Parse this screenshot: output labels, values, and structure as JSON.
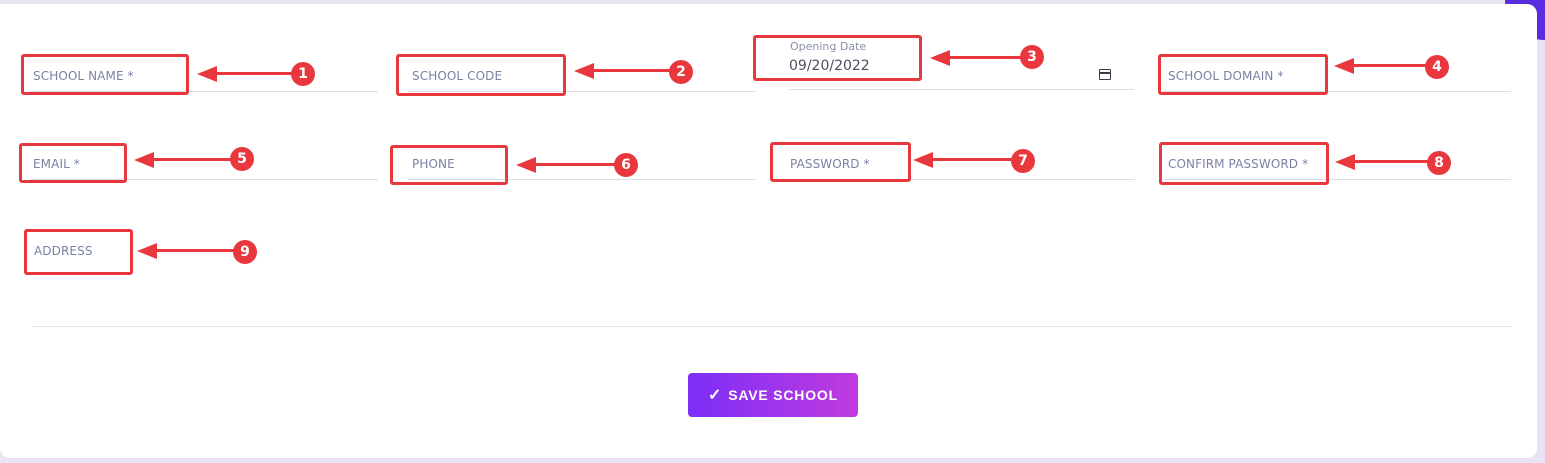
{
  "form": {
    "school_name_label": "SCHOOL NAME *",
    "school_code_label": "SCHOOL CODE",
    "opening_date_label": "Opening Date",
    "opening_date_value": "09/20/2022",
    "school_domain_label": "SCHOOL DOMAIN *",
    "email_label": "EMAIL *",
    "phone_label": "PHONE",
    "password_label": "PASSWORD *",
    "confirm_password_label": "CONFIRM PASSWORD *",
    "address_label": "ADDRESS"
  },
  "save_button": {
    "icon": "checkmark-icon",
    "check_glyph": "✓",
    "label": "SAVE SCHOOL"
  },
  "annotations": [
    "1",
    "2",
    "3",
    "4",
    "5",
    "6",
    "7",
    "8",
    "9"
  ],
  "colors": {
    "annotation": "#e8383d",
    "button_start": "#7b2ff7",
    "button_end": "#c13adf",
    "label": "#7b81a3"
  }
}
